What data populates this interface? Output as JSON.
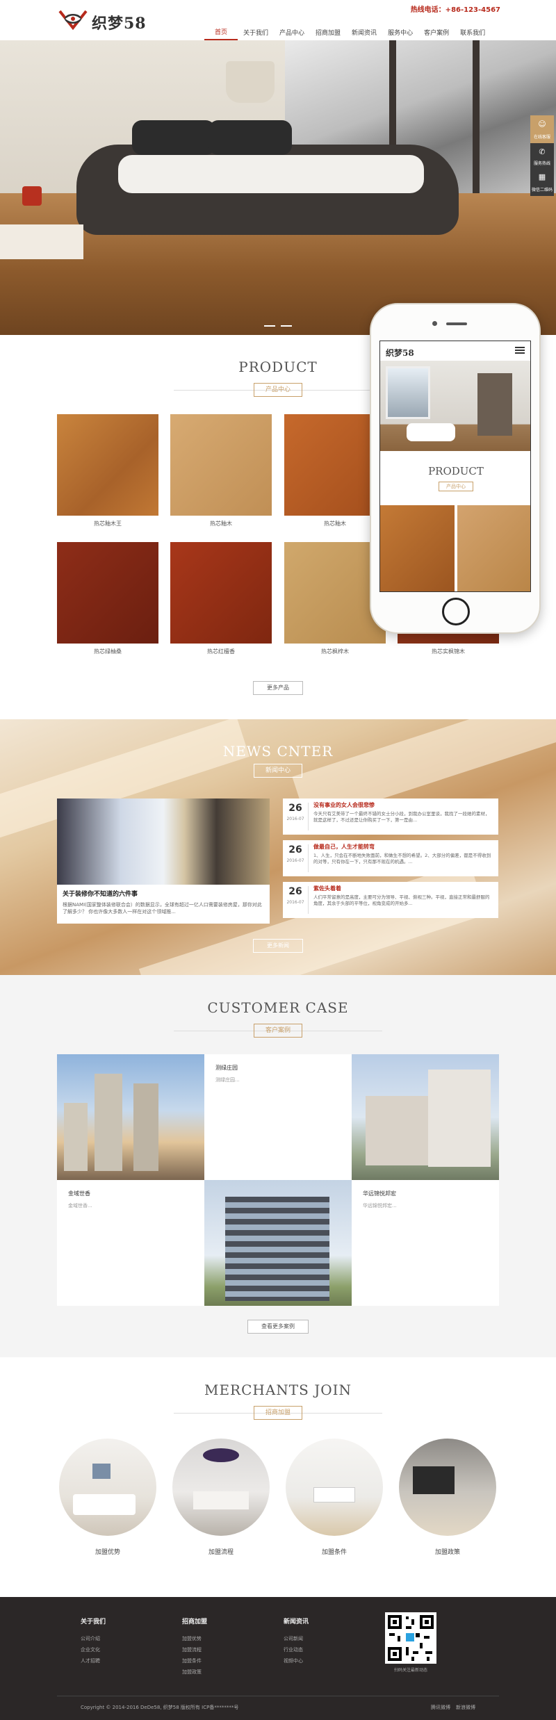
{
  "header": {
    "logo_text": "织梦58",
    "hotline": "热线电话：+86-123-4567",
    "nav": [
      "首页",
      "关于我们",
      "产品中心",
      "招商加盟",
      "新闻资讯",
      "服务中心",
      "客户案例",
      "联系我们"
    ],
    "active_index": 0
  },
  "side_float": {
    "items": [
      "在线客服",
      "服务热线",
      "微信二维码"
    ]
  },
  "product": {
    "title": "PRODUCT",
    "subtitle": "产品中心",
    "items": [
      "热芯釉木王",
      "热芯釉木",
      "热芯釉木",
      "热芯绿柚桑",
      "热芯红檀香",
      "热芯枫梓木",
      "热芯实枫锦木"
    ],
    "more": "更多产品"
  },
  "phone": {
    "logo": "织梦58",
    "title": "PRODUCT",
    "subtitle": "产品中心"
  },
  "news": {
    "title": "NEWS CNTER",
    "subtitle": "新闻中心",
    "main_title": "关于装修你不知道的六件事",
    "main_desc": "根据NAMI(国家整体装修联合会）的数据显示，全球有超过一亿人口需要装修房屋，那你对此了解多少？ 你也许像大多数人一样在对这个领域推...",
    "items": [
      {
        "day": "26",
        "ym": "2016-07",
        "title": "没有事业的女人会很悲惨",
        "desc": "今天只有艾美带了一个最终不错的女士分小段，到我办公室里谈，我找了一段她的素材，就是这样了，不过还是让你购买了一下，第一是由..."
      },
      {
        "day": "26",
        "ym": "2016-07",
        "title": "做最自己，人生才能转弯",
        "desc": "1、人生，只会在不断地失败面前，和做生不想的希望。2、大部分的偏差，都是不得收到的对等，只有你在一下，只有那不现在的机遇。..."
      },
      {
        "day": "26",
        "ym": "2016-07",
        "title": "紫佐头着着",
        "desc": "人们平常留意的是高度，主要可分为领导、平视、俯视三种。平视，直接正常和最舒服的角度，其余于头部的平等位，视角变成的开始多..."
      }
    ],
    "more": "更多新闻"
  },
  "case": {
    "title": "CUSTOMER CASE",
    "subtitle": "客户案例",
    "items": [
      {
        "title": "测绿庄园",
        "desc": "测绿庄园..."
      },
      {
        "title": "金域世香",
        "desc": "金域世香..."
      },
      {
        "title": "华远锦悦邦宏",
        "desc": "华远锦悦邦宏..."
      }
    ],
    "more": "查看更多案例"
  },
  "join": {
    "title": "MERCHANTS JOIN",
    "subtitle": "招商加盟",
    "items": [
      "加盟优势",
      "加盟流程",
      "加盟条件",
      "加盟政策"
    ]
  },
  "footer": {
    "cols": [
      {
        "head": "关于我们",
        "links": [
          "公司介绍",
          "企业文化",
          "人才招聘"
        ]
      },
      {
        "head": "招商加盟",
        "links": [
          "加盟优势",
          "加盟流程",
          "加盟条件",
          "加盟政策"
        ]
      },
      {
        "head": "新闻资讯",
        "links": [
          "公司新闻",
          "行业动态",
          "视频中心"
        ]
      }
    ],
    "qr_caption": "扫码关注最新动态",
    "copyright": "Copyright © 2014-2016 DeDe58, 织梦58 版权所有  ICP备********号",
    "social": [
      "腾讯微博",
      "新浪微博"
    ]
  },
  "colors": {
    "accent": "#b72a1c",
    "gold": "#c8a06a",
    "footer_bg": "#2b2727"
  }
}
